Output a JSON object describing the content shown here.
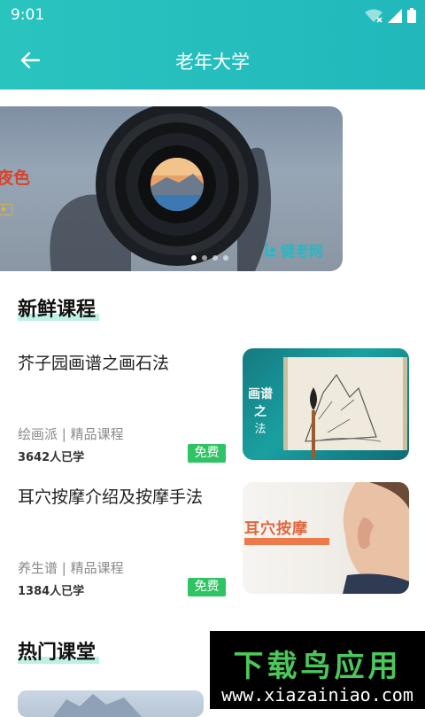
{
  "status_bar": {
    "time": "9:01"
  },
  "header": {
    "title": "老年大学"
  },
  "banner": {
    "text": "夜色",
    "brand": "键老网",
    "dots": 4,
    "active_dot": 1
  },
  "sections": {
    "fresh": "新鲜课程",
    "hot": "热门课堂"
  },
  "courses": [
    {
      "title": "芥子园画谱之画石法",
      "meta": "绘画派 | 精品课程",
      "learners": "3642人已学",
      "badge": "免费",
      "thumb_text_top": "画谱之",
      "thumb_text_bottom": "法"
    },
    {
      "title": "耳穴按摩介绍及按摩手法",
      "meta": "养生谱 | 精品课程",
      "learners": "1384人已学",
      "badge": "免费",
      "thumb_text": "耳穴按摩"
    }
  ],
  "watermark": {
    "title": "下载鸟应用",
    "url": "www.xiazainiao.com"
  },
  "colors": {
    "header": "#21b8bb",
    "free_badge": "#2fc463",
    "title_highlight": "#bff0e4",
    "watermark_green": "#4cc85a"
  }
}
